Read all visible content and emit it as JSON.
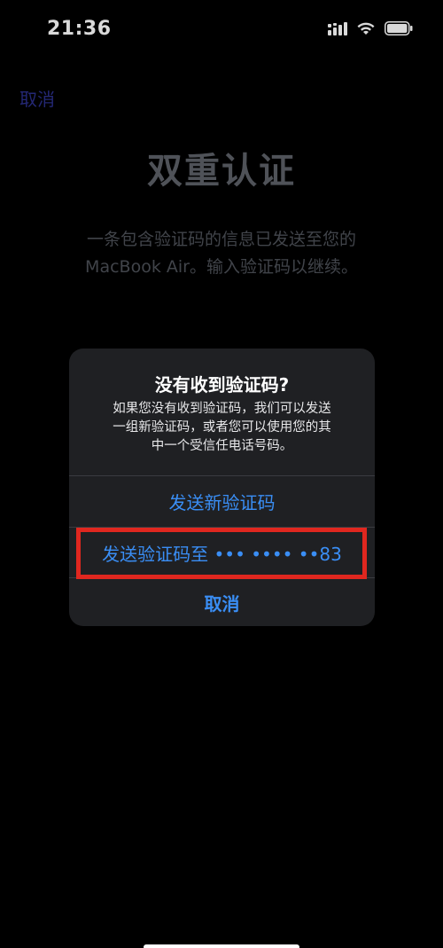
{
  "status_bar": {
    "time": "21:36"
  },
  "nav": {
    "cancel_label": "取消"
  },
  "page": {
    "title": "双重认证",
    "description_line1": "一条包含验证码的信息已发送至您的",
    "description_line2": "MacBook Air。输入验证码以继续。"
  },
  "alert": {
    "title": "没有收到验证码?",
    "message_line1": "如果您没有收到验证码，我们可以发送",
    "message_line2": "一组新验证码，或者您可以使用您的其",
    "message_line3": "中一个受信任电话号码。",
    "buttons": [
      {
        "label": "发送新验证码"
      },
      {
        "label": "发送验证码至 ••• •••• ••83"
      },
      {
        "label": "取消"
      }
    ]
  },
  "colors": {
    "accent": "#3a8ef5",
    "highlight": "#e0271f"
  }
}
